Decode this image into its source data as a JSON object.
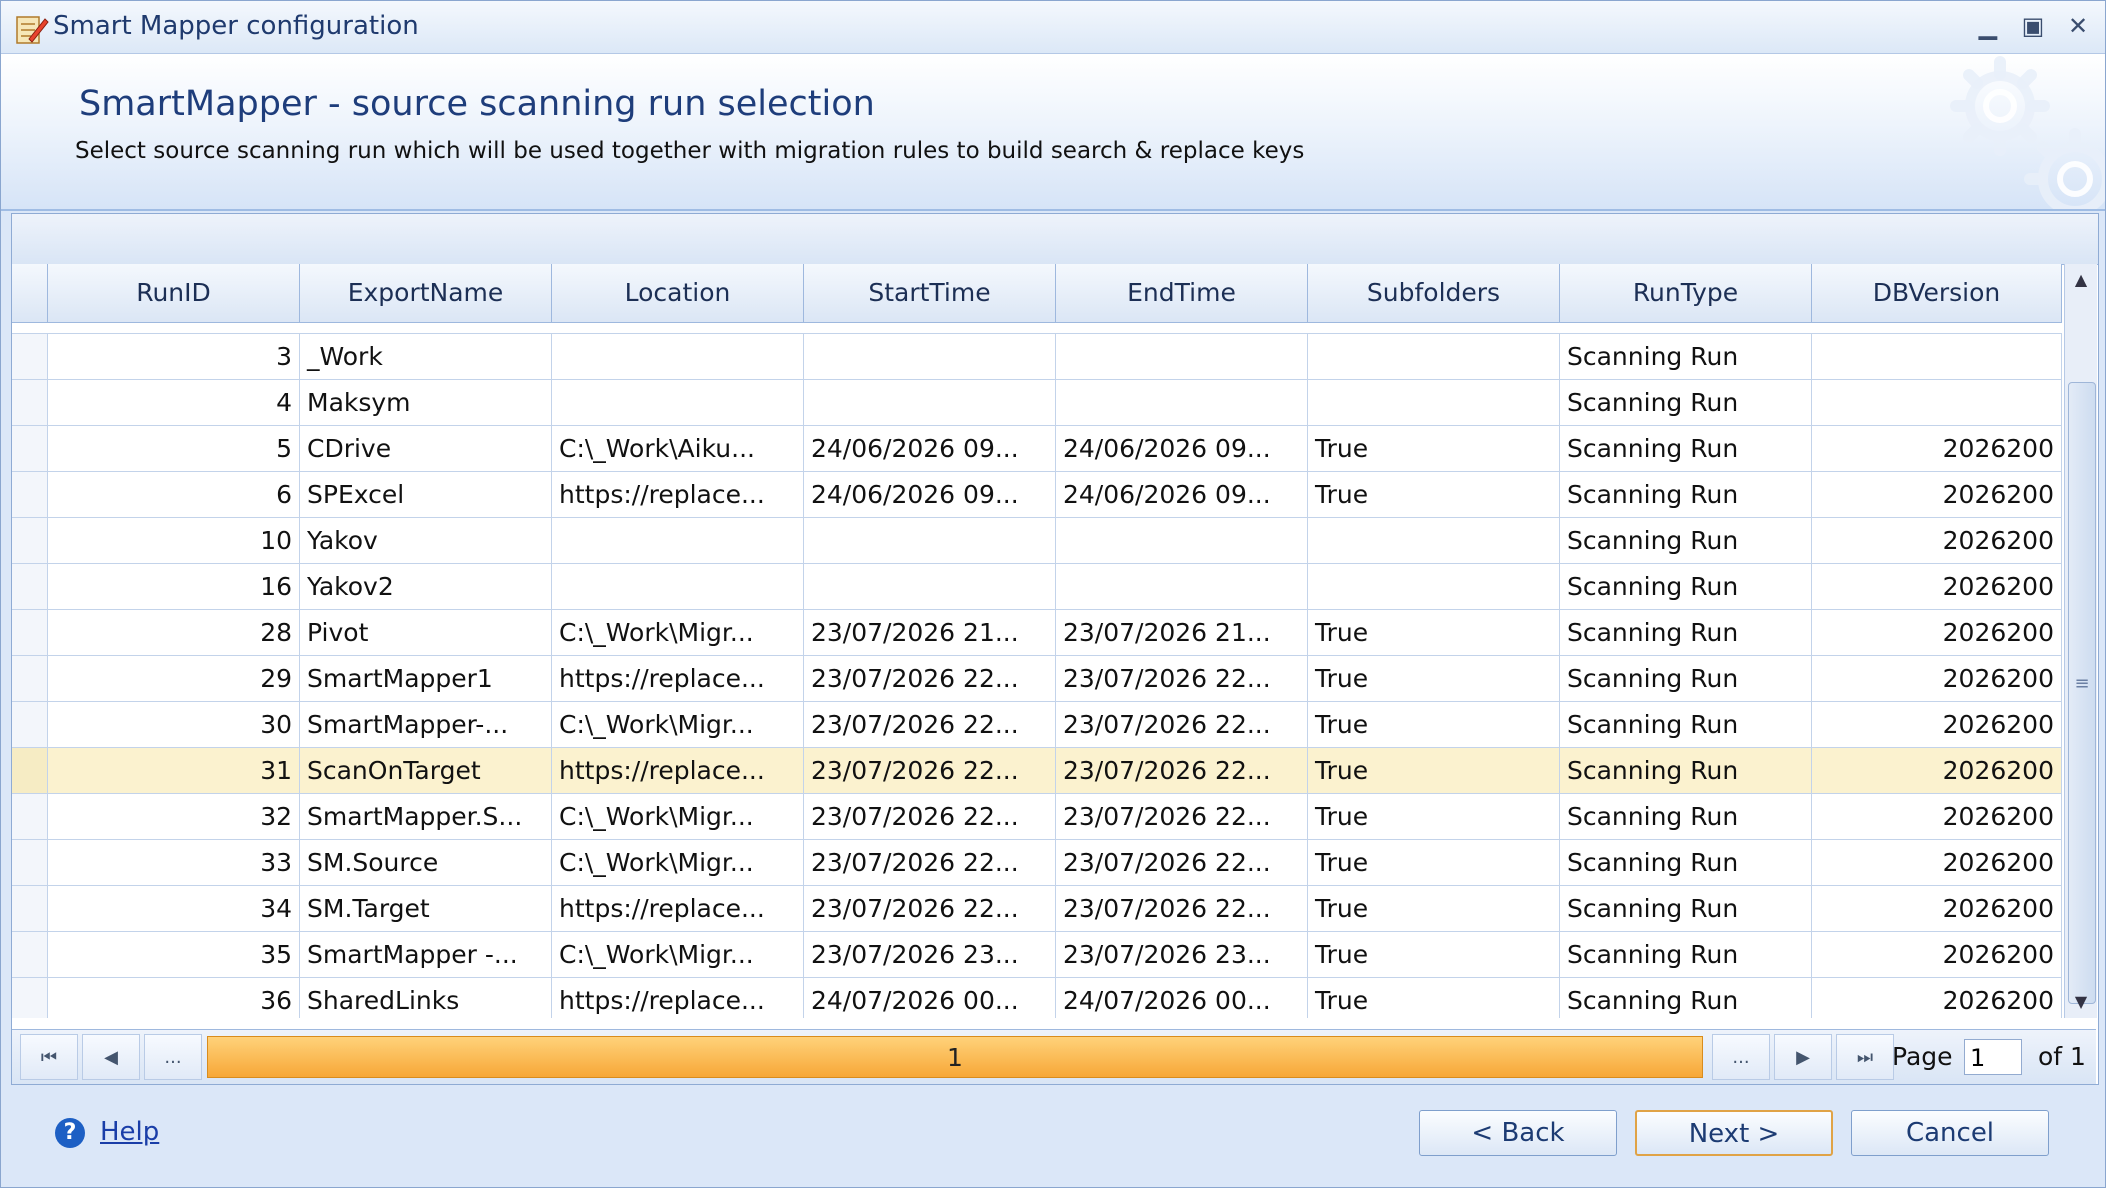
{
  "window": {
    "title": "Smart Mapper configuration",
    "minimize_glyph": "▁",
    "maximize_glyph": "▣",
    "close_glyph": "✕"
  },
  "header": {
    "title": "SmartMapper - source scanning run selection",
    "subtitle": "Select source scanning run which will be used together with migration rules to build search & replace keys"
  },
  "grid": {
    "columns": [
      "RunID",
      "ExportName",
      "Location",
      "StartTime",
      "EndTime",
      "Subfolders",
      "RunType",
      "DBVersion"
    ],
    "rows": [
      {
        "runid": "3",
        "export": "_Work",
        "location": "",
        "start": "",
        "end": "",
        "subfolders": "",
        "runtype": "Scanning Run",
        "dbversion": ""
      },
      {
        "runid": "4",
        "export": "Maksym",
        "location": "",
        "start": "",
        "end": "",
        "subfolders": "",
        "runtype": "Scanning Run",
        "dbversion": ""
      },
      {
        "runid": "5",
        "export": "CDrive",
        "location": "C:\\_Work\\Aiku...",
        "start": "24/06/2026  09...",
        "end": "24/06/2026  09...",
        "subfolders": "True",
        "runtype": "Scanning Run",
        "dbversion": "2026200"
      },
      {
        "runid": "6",
        "export": "SPExcel",
        "location": "https://replace...",
        "start": "24/06/2026  09...",
        "end": "24/06/2026  09...",
        "subfolders": "True",
        "runtype": "Scanning Run",
        "dbversion": "2026200"
      },
      {
        "runid": "10",
        "export": "Yakov",
        "location": "",
        "start": "",
        "end": "",
        "subfolders": "",
        "runtype": "Scanning Run",
        "dbversion": "2026200"
      },
      {
        "runid": "16",
        "export": "Yakov2",
        "location": "",
        "start": "",
        "end": "",
        "subfolders": "",
        "runtype": "Scanning Run",
        "dbversion": "2026200"
      },
      {
        "runid": "28",
        "export": "Pivot",
        "location": "C:\\_Work\\Migr...",
        "start": "23/07/2026  21...",
        "end": "23/07/2026  21...",
        "subfolders": "True",
        "runtype": "Scanning Run",
        "dbversion": "2026200"
      },
      {
        "runid": "29",
        "export": "SmartMapper1",
        "location": "https://replace...",
        "start": "23/07/2026  22...",
        "end": "23/07/2026  22...",
        "subfolders": "True",
        "runtype": "Scanning Run",
        "dbversion": "2026200"
      },
      {
        "runid": "30",
        "export": "SmartMapper-...",
        "location": "C:\\_Work\\Migr...",
        "start": "23/07/2026  22...",
        "end": "23/07/2026  22...",
        "subfolders": "True",
        "runtype": "Scanning Run",
        "dbversion": "2026200"
      },
      {
        "runid": "31",
        "export": "ScanOnTarget",
        "location": "https://replace...",
        "start": "23/07/2026  22...",
        "end": "23/07/2026  22...",
        "subfolders": "True",
        "runtype": "Scanning Run",
        "dbversion": "2026200",
        "selected": true
      },
      {
        "runid": "32",
        "export": "SmartMapper.S...",
        "location": "C:\\_Work\\Migr...",
        "start": "23/07/2026  22...",
        "end": "23/07/2026  22...",
        "subfolders": "True",
        "runtype": "Scanning Run",
        "dbversion": "2026200"
      },
      {
        "runid": "33",
        "export": "SM.Source",
        "location": "C:\\_Work\\Migr...",
        "start": "23/07/2026  22...",
        "end": "23/07/2026  22...",
        "subfolders": "True",
        "runtype": "Scanning Run",
        "dbversion": "2026200"
      },
      {
        "runid": "34",
        "export": "SM.Target",
        "location": "https://replace...",
        "start": "23/07/2026  22...",
        "end": "23/07/2026  22...",
        "subfolders": "True",
        "runtype": "Scanning Run",
        "dbversion": "2026200"
      },
      {
        "runid": "35",
        "export": "SmartMapper  -...",
        "location": "C:\\_Work\\Migr...",
        "start": "23/07/2026  23...",
        "end": "23/07/2026  23...",
        "subfolders": "True",
        "runtype": "Scanning Run",
        "dbversion": "2026200"
      },
      {
        "runid": "36",
        "export": "SharedLinks",
        "location": "https://replace...",
        "start": "24/07/2026  00...",
        "end": "24/07/2026  00...",
        "subfolders": "True",
        "runtype": "Scanning Run",
        "dbversion": "2026200"
      }
    ],
    "selected_color": "#fbf2cf"
  },
  "pager": {
    "first_glyph": "⏮",
    "prev_glyph": "◀",
    "ellipsis": "...",
    "current_page_button": "1",
    "next_glyph": "▶",
    "last_glyph": "⏭",
    "page_label": "Page",
    "page_value": "1",
    "of_label": "of 1",
    "accent_color": "#f7a737"
  },
  "footer": {
    "help_label": "Help",
    "back_label": "<   Back",
    "next_label": "Next   >",
    "cancel_label": "Cancel"
  }
}
